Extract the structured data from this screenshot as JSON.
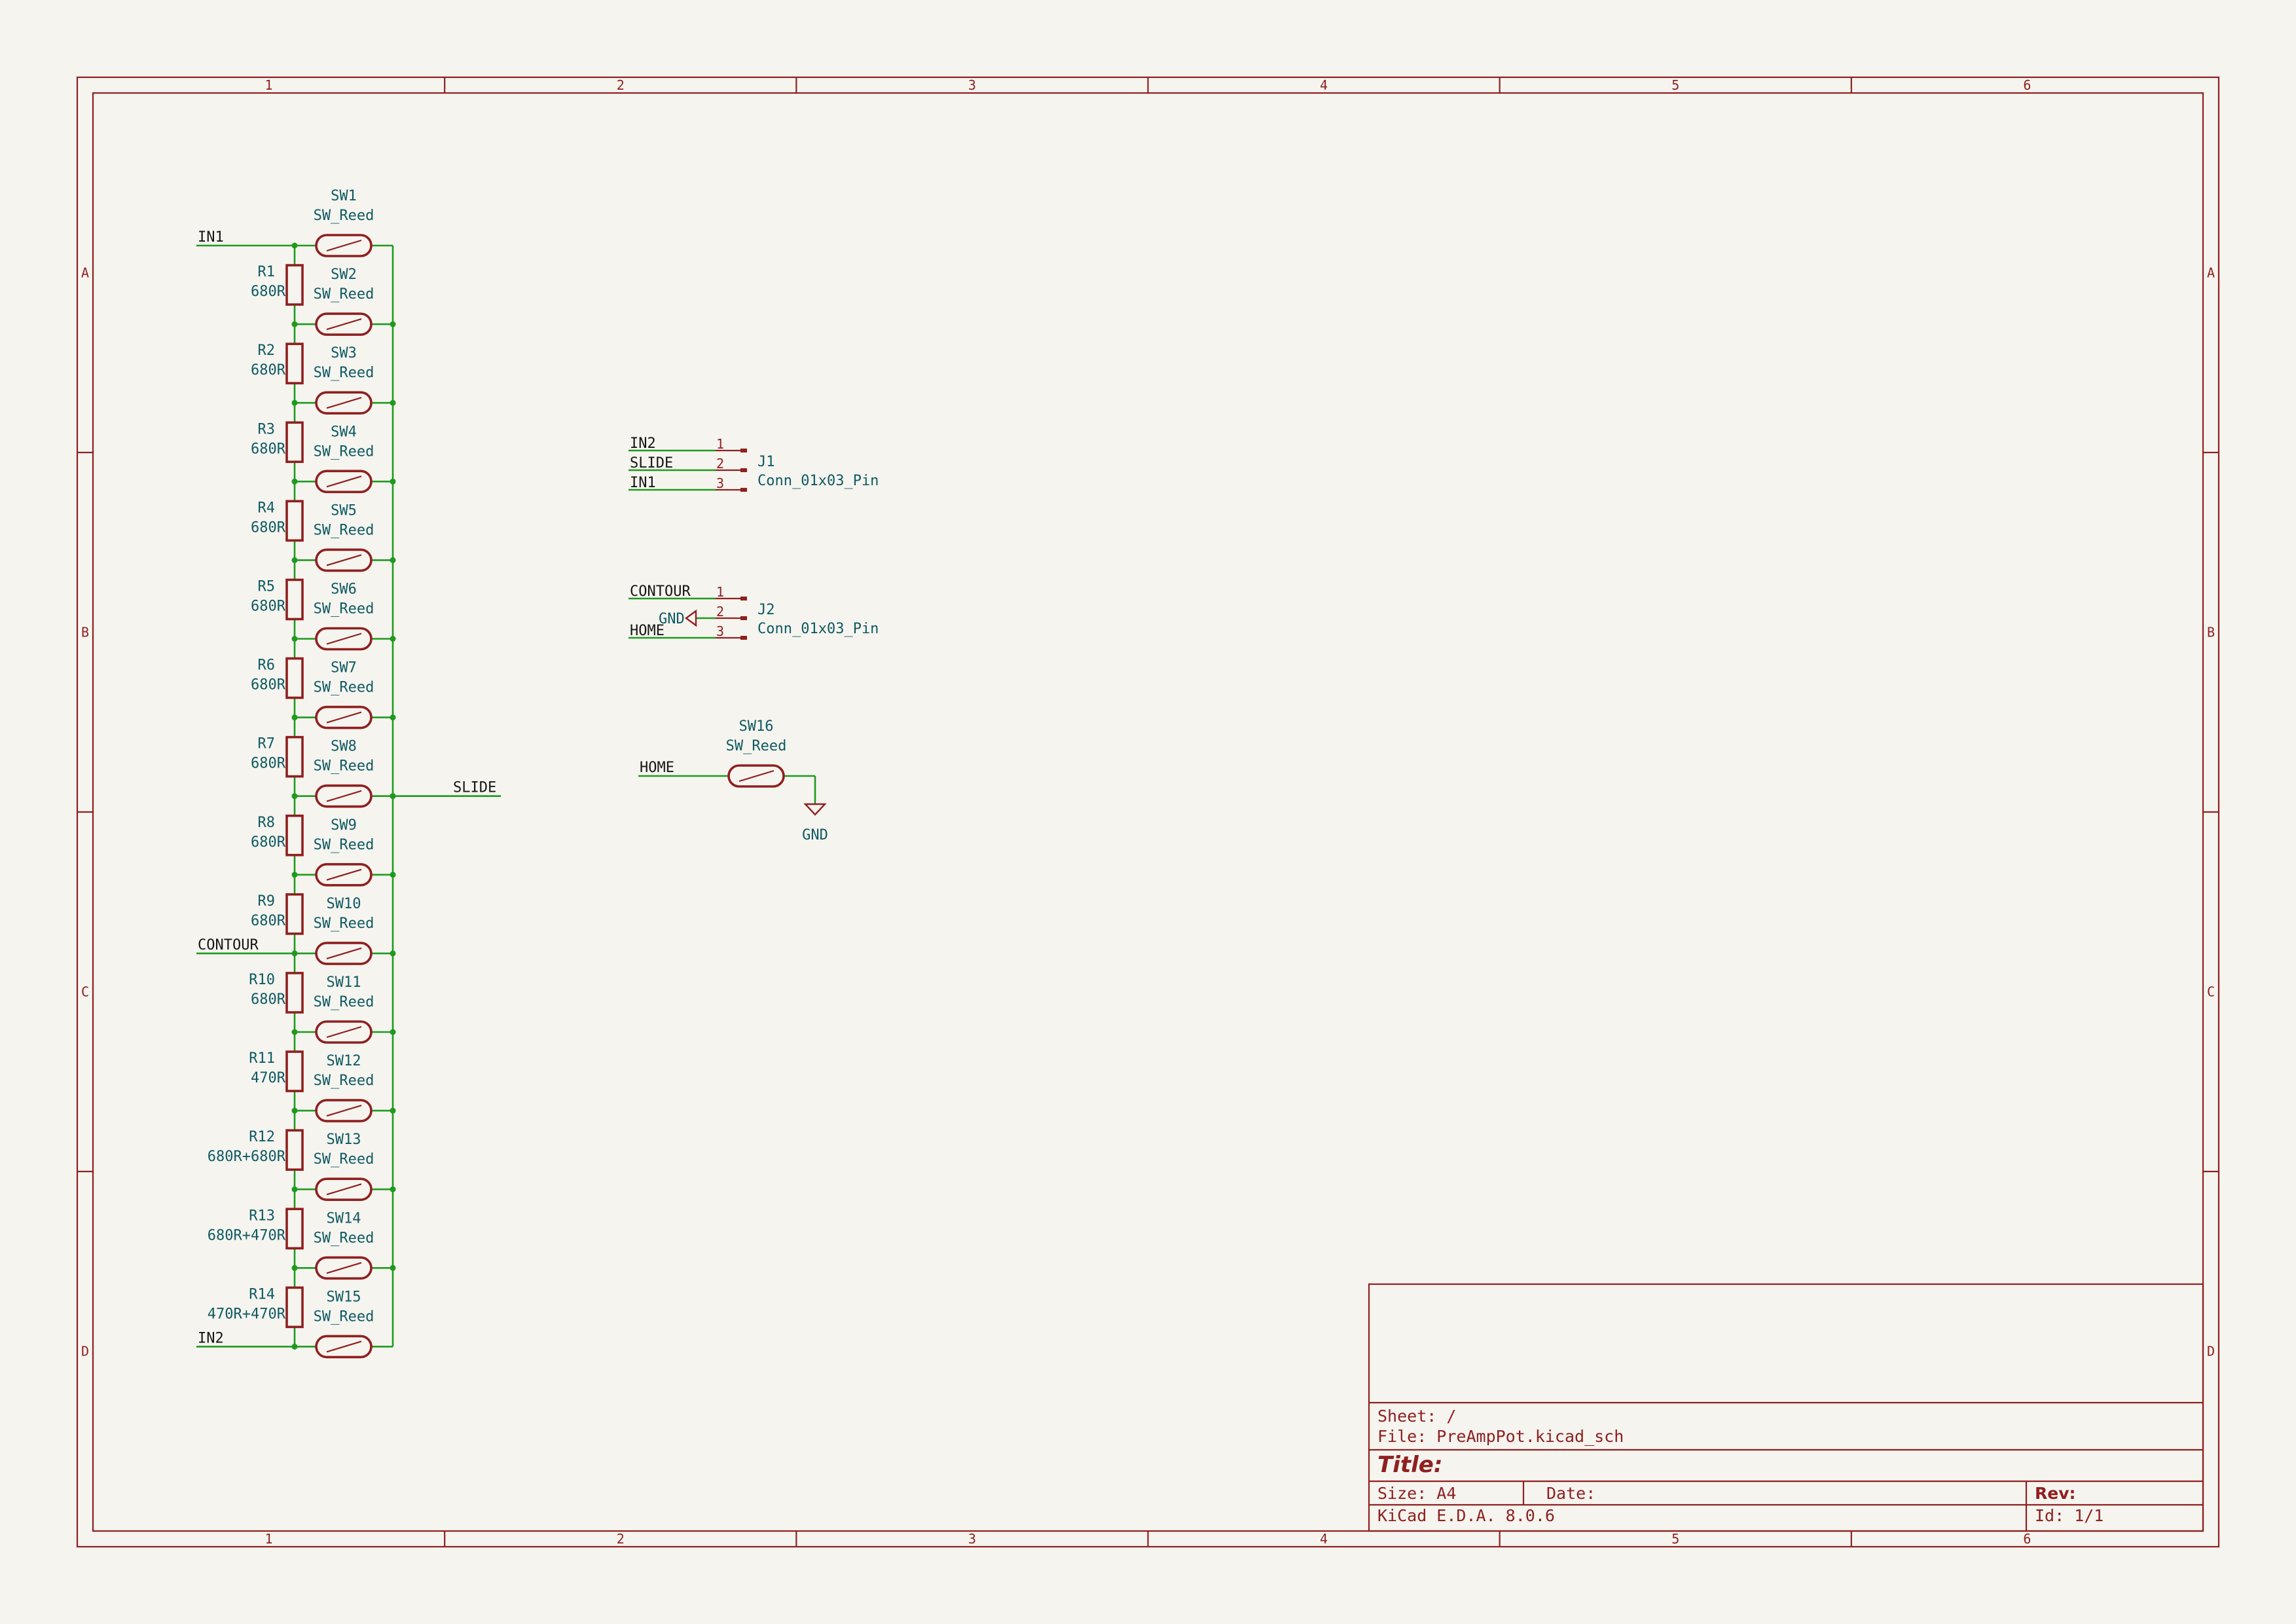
{
  "zones": {
    "columns": [
      "1",
      "2",
      "3",
      "4",
      "5",
      "6"
    ],
    "rows": [
      "A",
      "B",
      "C",
      "D"
    ]
  },
  "title_block": {
    "sheet": "Sheet: /",
    "file": "File: PreAmpPot.kicad_sch",
    "title": "Title:",
    "size": "Size: A4",
    "date": "Date:",
    "rev": "Rev:",
    "generator": "KiCad E.D.A. 8.0.6",
    "id": "Id: 1/1"
  },
  "ladder": {
    "resistors": [
      {
        "ref": "R1",
        "value": "680R"
      },
      {
        "ref": "R2",
        "value": "680R"
      },
      {
        "ref": "R3",
        "value": "680R"
      },
      {
        "ref": "R4",
        "value": "680R"
      },
      {
        "ref": "R5",
        "value": "680R"
      },
      {
        "ref": "R6",
        "value": "680R"
      },
      {
        "ref": "R7",
        "value": "680R"
      },
      {
        "ref": "R8",
        "value": "680R"
      },
      {
        "ref": "R9",
        "value": "680R"
      },
      {
        "ref": "R10",
        "value": "680R"
      },
      {
        "ref": "R11",
        "value": "470R"
      },
      {
        "ref": "R12",
        "value": "680R+680R"
      },
      {
        "ref": "R13",
        "value": "680R+470R"
      },
      {
        "ref": "R14",
        "value": "470R+470R"
      }
    ],
    "switches": [
      {
        "ref": "SW1",
        "value": "SW_Reed"
      },
      {
        "ref": "SW2",
        "value": "SW_Reed"
      },
      {
        "ref": "SW3",
        "value": "SW_Reed"
      },
      {
        "ref": "SW4",
        "value": "SW_Reed"
      },
      {
        "ref": "SW5",
        "value": "SW_Reed"
      },
      {
        "ref": "SW6",
        "value": "SW_Reed"
      },
      {
        "ref": "SW7",
        "value": "SW_Reed"
      },
      {
        "ref": "SW8",
        "value": "SW_Reed"
      },
      {
        "ref": "SW9",
        "value": "SW_Reed"
      },
      {
        "ref": "SW10",
        "value": "SW_Reed"
      },
      {
        "ref": "SW11",
        "value": "SW_Reed"
      },
      {
        "ref": "SW12",
        "value": "SW_Reed"
      },
      {
        "ref": "SW13",
        "value": "SW_Reed"
      },
      {
        "ref": "SW14",
        "value": "SW_Reed"
      },
      {
        "ref": "SW15",
        "value": "SW_Reed"
      }
    ],
    "labels": {
      "in1": "IN1",
      "contour": "CONTOUR",
      "in2": "IN2",
      "slide": "SLIDE"
    }
  },
  "j1": {
    "ref": "J1",
    "value": "Conn_01x03_Pin",
    "pins": [
      {
        "num": "1",
        "net": "IN2"
      },
      {
        "num": "2",
        "net": "SLIDE"
      },
      {
        "num": "3",
        "net": "IN1"
      }
    ]
  },
  "j2": {
    "ref": "J2",
    "value": "Conn_01x03_Pin",
    "pins": [
      {
        "num": "1",
        "net": "CONTOUR"
      },
      {
        "num": "2",
        "net": "GND"
      },
      {
        "num": "3",
        "net": "HOME"
      }
    ]
  },
  "sw16": {
    "ref": "SW16",
    "value": "SW_Reed",
    "net": "HOME",
    "gnd": "GND"
  }
}
